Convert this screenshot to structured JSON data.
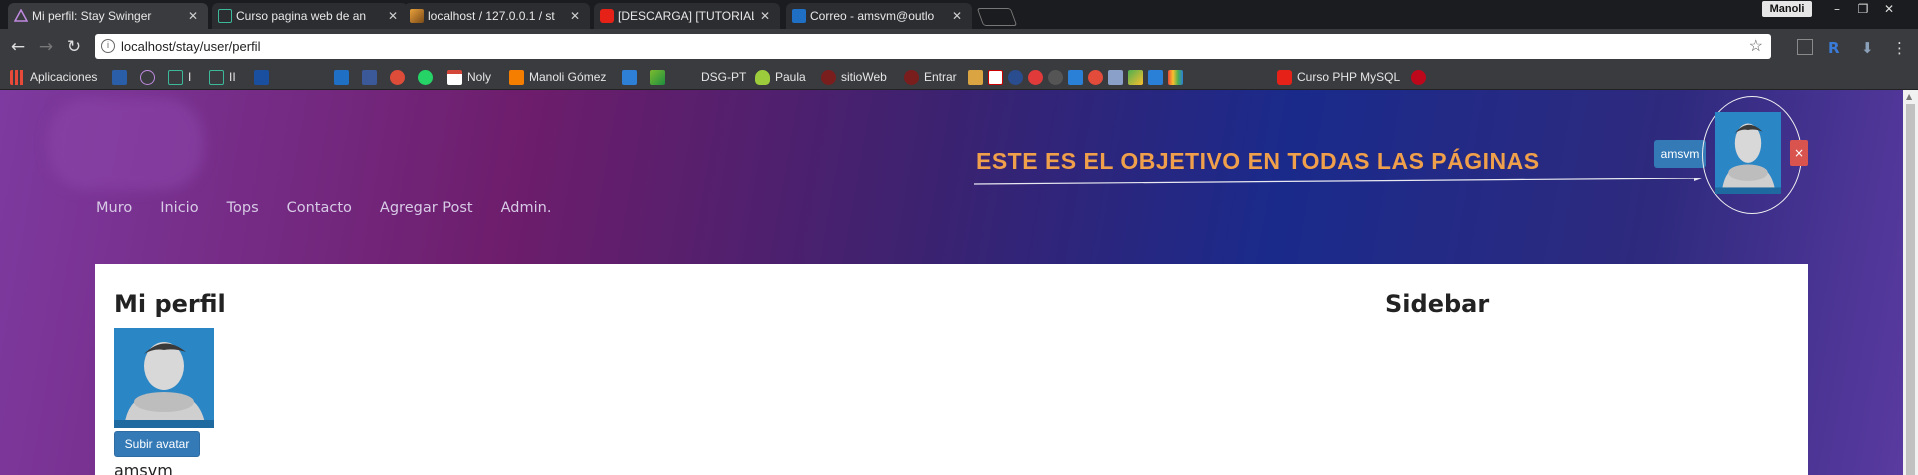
{
  "browser": {
    "tabs": [
      {
        "title": "Mi perfil: Stay Swinger",
        "active": true,
        "favicon": "stay-logo-icon"
      },
      {
        "title": "Curso pagina web de an",
        "favicon": "course-icon"
      },
      {
        "title": "localhost / 127.0.0.1 / st",
        "favicon": "phpmyadmin-icon"
      },
      {
        "title": "[DESCARGA] [TUTORIAL]",
        "favicon": "youtube-icon"
      },
      {
        "title": "Correo - amsvm@outlo",
        "favicon": "outlook-icon"
      }
    ],
    "profile_name": "Manoli",
    "url": "localhost/stay/user/perfil",
    "bookmarks": [
      {
        "label": "Aplicaciones",
        "icon": "apps-grid-icon"
      },
      {
        "label": "",
        "icon": "ts-icon"
      },
      {
        "label": "",
        "icon": "stay-logo-icon"
      },
      {
        "label": "I",
        "icon": "course-icon"
      },
      {
        "label": "II",
        "icon": "course-icon"
      },
      {
        "label": "",
        "icon": "paypal-icon"
      },
      {
        "label": "",
        "icon": "outlook-icon"
      },
      {
        "label": "",
        "icon": "facebook-icon"
      },
      {
        "label": "",
        "icon": "google-plus-icon"
      },
      {
        "label": "",
        "icon": "whatsapp-icon"
      },
      {
        "label": "Noly",
        "icon": "gmail-icon"
      },
      {
        "label": "Manoli Gómez",
        "icon": "blogger-icon"
      },
      {
        "label": "",
        "icon": "x-tool-icon"
      },
      {
        "label": "DSG-PT",
        "icon": "kotlin-icon"
      },
      {
        "label": "Paula",
        "icon": "bulb-icon"
      },
      {
        "label": "sitioWeb",
        "icon": "web-icon"
      },
      {
        "label": "Entrar",
        "icon": "web-icon"
      },
      {
        "label": "Curso PHP MySQL",
        "icon": "youtube-icon"
      }
    ]
  },
  "annotation": {
    "text": "ESTE ES EL OBJETIVO EN TODAS LAS PÁGINAS"
  },
  "header": {
    "user_label": "amsvm",
    "close_label": "×"
  },
  "nav": {
    "items": [
      "Muro",
      "Inicio",
      "Tops",
      "Contacto",
      "Agregar Post",
      "Admin."
    ]
  },
  "main": {
    "title": "Mi perfil",
    "upload_label": "Subir avatar",
    "username": "amsvm"
  },
  "sidebar": {
    "title": "Sidebar"
  },
  "colors": {
    "primary_button": "#337ab7",
    "danger_button": "#d9534f",
    "annotation": "#f0a04a"
  }
}
